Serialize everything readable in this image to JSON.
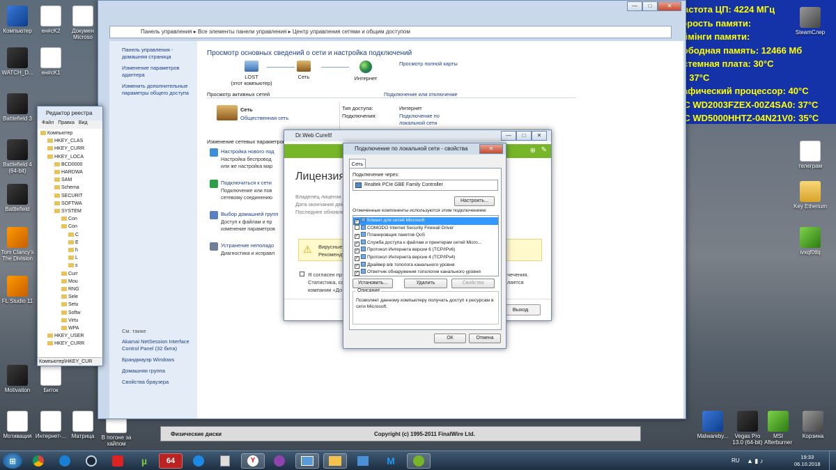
{
  "aida_overlay": [
    "Частота ЦП: 4224 МГц",
    "корость памяти:",
    "аймінги памяти:",
    "вободная память: 12466 Мб",
    "истемная плата: 30°C",
    "П: 37°C",
    "рафический процессор: 40°C",
    "DC WD2003FZEX-00Z4SA0: 37°C",
    "DC WD5000HHTZ-04N21V0: 35°C"
  ],
  "desktop_left": [
    {
      "label": "Компьютер"
    },
    {
      "label": "ен#сK2"
    },
    {
      "label": "Докумен Microso"
    },
    {
      "label": "WATCH_D..."
    },
    {
      "label": "ен#сK1"
    },
    {
      "label": "Battlefield 3"
    },
    {
      "label": "Battlefield 4 (64-bit)"
    },
    {
      "label": "Battlefield"
    },
    {
      "label": "Tom Clancy's The Division"
    },
    {
      "label": "FL Studio 11"
    },
    {
      "label": "Motivation"
    },
    {
      "label": "Биток"
    }
  ],
  "desktop_bottom": [
    {
      "label": "Мотивация"
    },
    {
      "label": "Интернет-..."
    },
    {
      "label": "Матрица"
    },
    {
      "label": "В погоне за хайпом"
    }
  ],
  "desktop_right": [
    {
      "label": "SteamСлeр"
    },
    {
      "label": "телеграм"
    },
    {
      "label": "Key Etherium"
    },
    {
      "label": "ivxqf0tlq"
    },
    {
      "label": "Malwareby..."
    },
    {
      "label": "Vegas Pro 13.0 (64-bit)"
    },
    {
      "label": "MSI Afterburner"
    },
    {
      "label": "Корзина"
    }
  ],
  "control_panel": {
    "breadcrumb": [
      "Панель управления",
      "Все элементы панели управления",
      "Центр управления сетями и общим доступом"
    ],
    "sidebar_links": [
      "Панель управления - домашняя страница",
      "Изменение параметров адаптера",
      "Изменить дополнительные параметры общего доступа"
    ],
    "see_also_title": "См. также",
    "see_also": [
      "Akamai NetSession Interface Control Panel (32 бита)",
      "Брандмауэр Windows",
      "Домашняя группа",
      "Свойства браузера"
    ],
    "heading": "Просмотр основных сведений о сети и настройка подключений",
    "full_map": "Просмотр полной карты",
    "node_pc": "LOST",
    "node_pc_sub": "(этот компьютер)",
    "node_net": "Сеть",
    "node_internet": "Интернет",
    "active_title": "Просмотр активных сетей",
    "connect_link": "Подключение или отключение",
    "network_name": "Сеть",
    "network_type": "Общественная сеть",
    "access_label": "Тип доступа:",
    "access_value": "Интернет",
    "conn_label": "Подключения:",
    "conn_value": "Подключение по локальной сети",
    "change_title": "Изменение сетевых параметров",
    "tasks": [
      {
        "title": "Настройка нового под",
        "desc": "Настройка беспровод или же настройка мар"
      },
      {
        "title": "Подключиться к сети",
        "desc": "Подключение или пов сетевому соединению"
      },
      {
        "title": "Выбор домашней групп",
        "desc": "Доступ к файлам и пр изменение параметров"
      },
      {
        "title": "Устранение неполадо",
        "desc": "Диагностика и исправл"
      }
    ]
  },
  "aida_footer": {
    "left": "Физические диски",
    "center": "Copyright (c) 1995-2011 FinalWire Ltd."
  },
  "regedit": {
    "title": "Редактор реестра",
    "menu": [
      "Файл",
      "Правка",
      "Вид"
    ],
    "tree": [
      "Компьютер",
      "HKEY_CLAS",
      "HKEY_CURR",
      "HKEY_LOCA",
      "BCD0000",
      "HARDWA",
      "SAM",
      "Schema",
      "SECURIT",
      "SOFTWA",
      "SYSTEM",
      "Con",
      "Con",
      "C",
      "E",
      "h",
      "L",
      "s",
      "Curr",
      "Mou",
      "RNG",
      "Sele",
      "Setu",
      "Softw",
      "Virtu",
      "WPA",
      "HKEY_USER",
      "HKEY_CURR"
    ],
    "status": "Компьютер\\HKEY_CUR"
  },
  "drweb": {
    "title": "Dr.Web CureIt!",
    "heading": "Лицензия",
    "fields": [
      "Владелец лицензи",
      "Дата окончания дей",
      "Последнее обновле"
    ],
    "warning_lines": [
      "Вирусные",
      "Рекоменду"
    ],
    "agree_lines": [
      "Я согласен пр",
      "Статистика, соб",
      "компании «До"
    ],
    "right_lines": [
      "чечения.",
      "ляется"
    ],
    "exit_button": "Выход"
  },
  "props": {
    "title": "Подключение по локальной сети - свойства",
    "tab": "Сеть",
    "connect_via_label": "Подключение через:",
    "adapter": "Realtek PCIe GBE Family Controller",
    "configure_button": "Настроить...",
    "components_label": "Отмеченные компоненты используются этим подключением:",
    "components": [
      {
        "label": "Клиент для сетей Microsoft",
        "checked": true,
        "selected": true
      },
      {
        "label": "COMODO Internet Security Firewall Driver",
        "checked": false,
        "selected": false
      },
      {
        "label": "Планировщик пакетов QoS",
        "checked": true,
        "selected": false
      },
      {
        "label": "Служба доступа к файлам и принтерам сетей Micro...",
        "checked": true,
        "selected": false
      },
      {
        "label": "Протокол Интернета версии 6 (TCP/IPv6)",
        "checked": true,
        "selected": false
      },
      {
        "label": "Протокол Интернета версии 4 (TCP/IPv4)",
        "checked": true,
        "selected": false
      },
      {
        "label": "Драйвер в/в тополога канального уровня",
        "checked": true,
        "selected": false
      },
      {
        "label": "Ответчик обнаружения топологии канального уровня",
        "checked": true,
        "selected": false
      }
    ],
    "install_button": "Установить...",
    "remove_button": "Удалить",
    "properties_button": "Свойства",
    "description_title": "Описание",
    "description": "Позволяет данному компьютеру получать доступ к ресурсам в сети Microsoft.",
    "ok_button": "ОК",
    "cancel_button": "Отмена"
  },
  "taskbar": {
    "items": [
      "windows-orb",
      "chrome",
      "uplay",
      "steam",
      "firewall",
      "utorrent",
      "aida64",
      "speed",
      "calc",
      "yandex",
      "browser",
      "network",
      "explorer",
      "malwarebytes",
      "cureit"
    ],
    "aida_label": "64",
    "lang": "RU",
    "time": "19:33",
    "date": "06.10.2018"
  }
}
